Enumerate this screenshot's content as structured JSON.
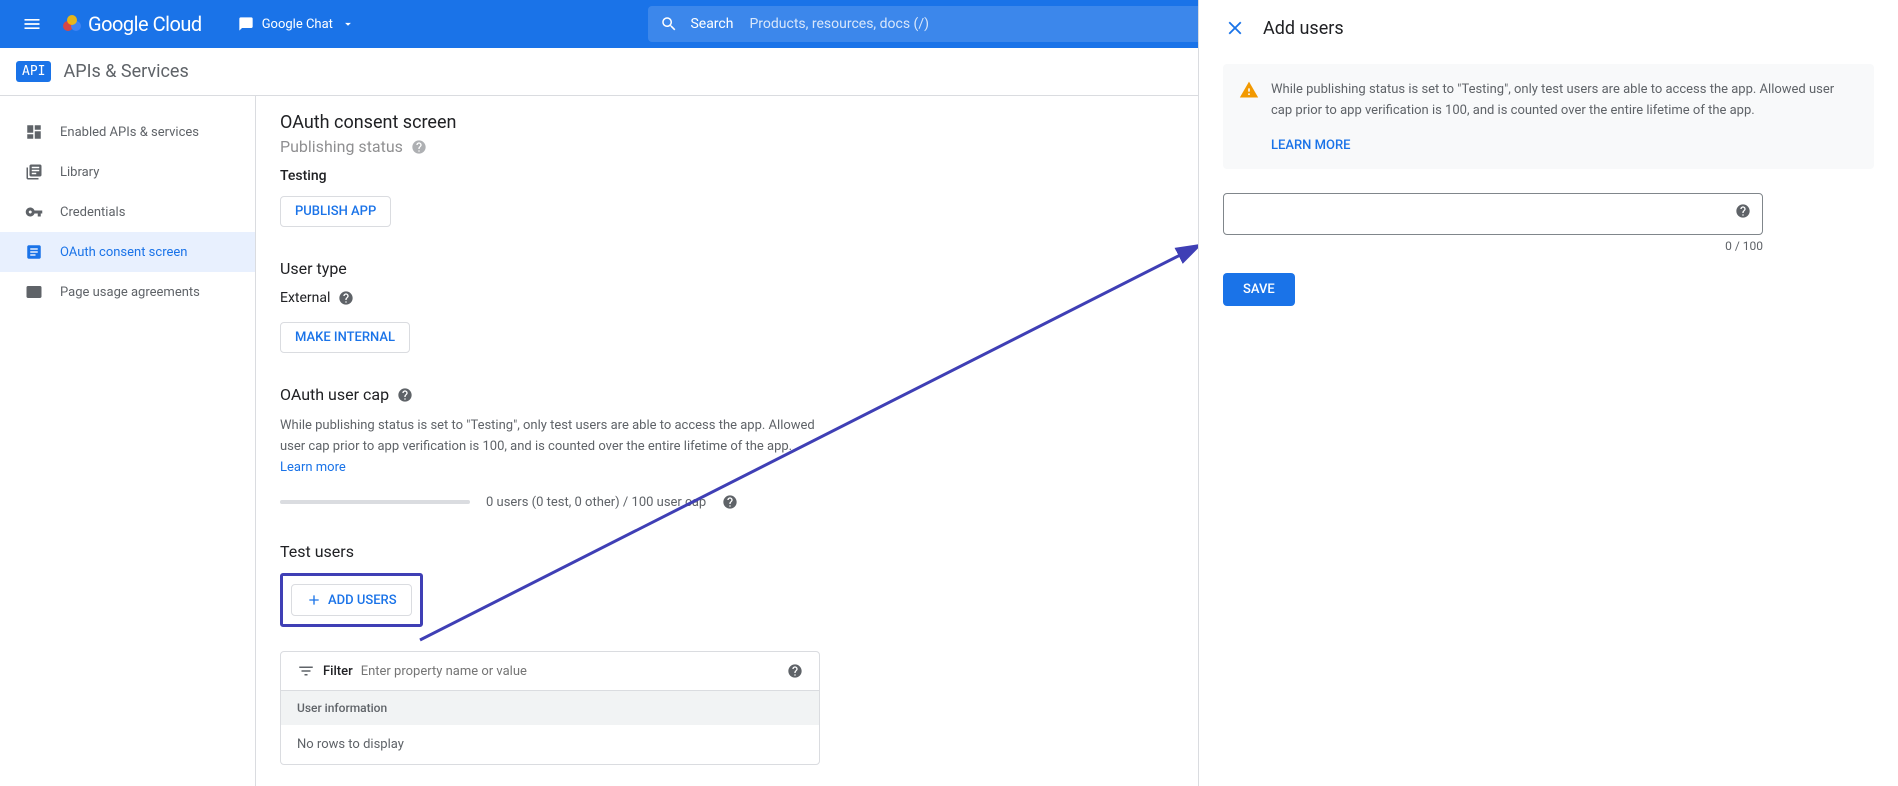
{
  "header": {
    "logo_text": "Google Cloud",
    "project_name": "Google Chat",
    "search_label": "Search",
    "search_placeholder": "Products, resources, docs (/)"
  },
  "secondary_header": {
    "badge": "API",
    "title": "APIs & Services"
  },
  "sidebar": {
    "items": [
      {
        "label": "Enabled APIs & services",
        "active": false
      },
      {
        "label": "Library",
        "active": false
      },
      {
        "label": "Credentials",
        "active": false
      },
      {
        "label": "OAuth consent screen",
        "active": true
      },
      {
        "label": "Page usage agreements",
        "active": false
      }
    ]
  },
  "content": {
    "page_title": "OAuth consent screen",
    "publishing_section": {
      "heading": "Publishing status",
      "status": "Testing",
      "button": "PUBLISH APP"
    },
    "user_type_section": {
      "heading": "User type",
      "value": "External",
      "button": "MAKE INTERNAL"
    },
    "user_cap_section": {
      "heading": "OAuth user cap",
      "description": "While publishing status is set to \"Testing\", only test users are able to access the app. Allowed user cap prior to app verification is 100, and is counted over the entire lifetime of the app.",
      "learn_more": "Learn more",
      "progress_text": "0 users (0 test, 0 other) / 100 user cap"
    },
    "test_users_section": {
      "heading": "Test users",
      "add_button": "ADD USERS",
      "filter_label": "Filter",
      "filter_placeholder": "Enter property name or value",
      "table_header": "User information",
      "empty_text": "No rows to display"
    }
  },
  "panel": {
    "title": "Add users",
    "warning_text": "While publishing status is set to \"Testing\", only test users are able to access the app. Allowed user cap prior to app verification is 100, and is counted over the entire lifetime of the app.",
    "learn_more": "LEARN MORE",
    "counter": "0 / 100",
    "save_button": "SAVE"
  }
}
